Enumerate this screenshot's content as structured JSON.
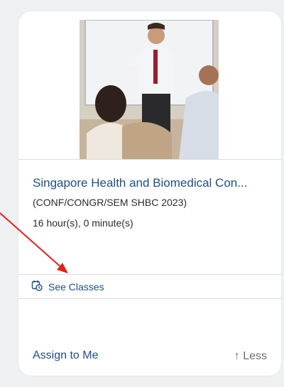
{
  "course": {
    "title": "Singapore Health and Biomedical Con...",
    "code": "(CONF/CONGR/SEM SHBC 2023)",
    "duration": "16 hour(s), 0 minute(s)"
  },
  "actions": {
    "see_classes": "See Classes",
    "see_classes_icon": "calendar-clock-icon",
    "assign": "Assign to Me",
    "less": "↑ Less"
  },
  "colors": {
    "link": "#1f4e8c",
    "annotation": "#e0241b"
  }
}
